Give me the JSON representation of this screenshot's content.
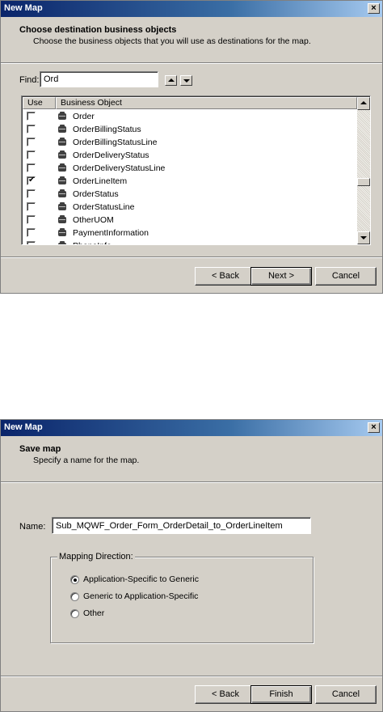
{
  "dialog1": {
    "title": "New Map",
    "header_title": "Choose destination business objects",
    "header_subtitle": "Choose the business objects that you will use as destinations for the map.",
    "find_label": "Find:",
    "find_value": "Ord",
    "columns": [
      "Use",
      "Business Object"
    ],
    "rows": [
      {
        "label": "Order",
        "checked": false
      },
      {
        "label": "OrderBillingStatus",
        "checked": false
      },
      {
        "label": "OrderBillingStatusLine",
        "checked": false
      },
      {
        "label": "OrderDeliveryStatus",
        "checked": false
      },
      {
        "label": "OrderDeliveryStatusLine",
        "checked": false
      },
      {
        "label": "OrderLineItem",
        "checked": true
      },
      {
        "label": "OrderStatus",
        "checked": false
      },
      {
        "label": "OrderStatusLine",
        "checked": false
      },
      {
        "label": "OtherUOM",
        "checked": false
      },
      {
        "label": "PaymentInformation",
        "checked": false
      },
      {
        "label": "PhoneInfo",
        "checked": false
      }
    ],
    "buttons": {
      "back": "< Back",
      "next": "Next >",
      "cancel": "Cancel"
    }
  },
  "dialog2": {
    "title": "New Map",
    "header_title": "Save map",
    "header_subtitle": "Specify a name for the map.",
    "name_label": "Name:",
    "name_value": "Sub_MQWF_Order_Form_OrderDetail_to_OrderLineItem",
    "group_title": "Mapping Direction:",
    "options": [
      {
        "label": "Application-Specific to Generic",
        "selected": true
      },
      {
        "label": "Generic to Application-Specific",
        "selected": false
      },
      {
        "label": "Other",
        "selected": false
      }
    ],
    "buttons": {
      "back": "< Back",
      "finish": "Finish",
      "cancel": "Cancel"
    }
  },
  "icons": {
    "close": "close-icon",
    "business_object": "business-object-icon"
  },
  "colors": {
    "titlebar_start": "#0a246a",
    "titlebar_end": "#a6caf0",
    "dialog_bg": "#d4d0c8"
  }
}
